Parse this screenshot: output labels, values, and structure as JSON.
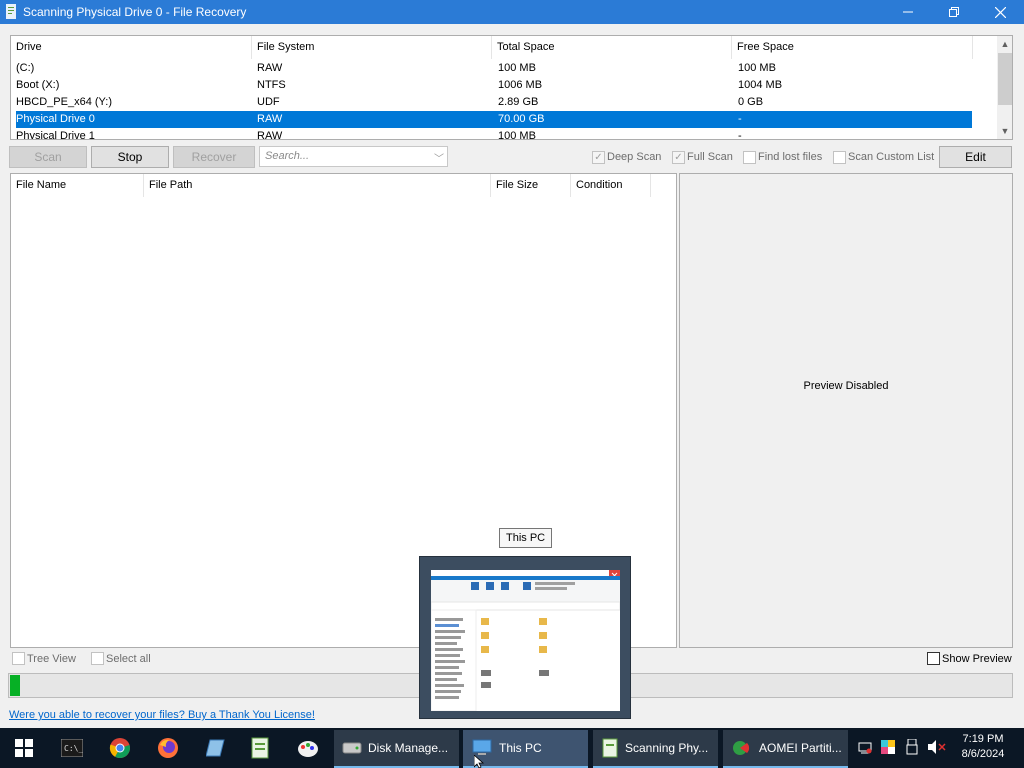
{
  "window": {
    "title": "Scanning Physical Drive 0 - File Recovery",
    "controls": {
      "minimize": "—",
      "restore": "❐",
      "close": "✕"
    }
  },
  "drive_table": {
    "columns": [
      "Drive",
      "File System",
      "Total Space",
      "Free Space"
    ],
    "rows": [
      {
        "drive": " (C:)",
        "fs": "RAW",
        "total": "100 MB",
        "free": "100 MB"
      },
      {
        "drive": "Boot (X:)",
        "fs": "NTFS",
        "total": "1006 MB",
        "free": "1004 MB"
      },
      {
        "drive": "HBCD_PE_x64 (Y:)",
        "fs": "UDF",
        "total": "2.89 GB",
        "free": "0 GB"
      },
      {
        "drive": "Physical Drive 0",
        "fs": "RAW",
        "total": "70.00 GB",
        "free": "-"
      },
      {
        "drive": "Physical Drive 1",
        "fs": "RAW",
        "total": "100 MB",
        "free": "-"
      }
    ],
    "selected_row": "Physical Drive 0"
  },
  "toolbar": {
    "scan": "Scan",
    "stop": "Stop",
    "recover": "Recover",
    "search_placeholder": "Search...",
    "deep_scan": "Deep Scan",
    "full_scan": "Full Scan",
    "find_lost_files": "Find lost files",
    "scan_custom_list": "Scan Custom List",
    "edit": "Edit"
  },
  "file_table": {
    "columns": [
      "File Name",
      "File Path",
      "File Size",
      "Condition"
    ]
  },
  "preview": {
    "text": "Preview Disabled"
  },
  "options": {
    "tree_view": "Tree View",
    "select_all": "Select all",
    "show_preview": "Show Preview"
  },
  "progress": {
    "fraction": 0.01
  },
  "link_text": "Were you able to recover your files? Buy a Thank You License!",
  "tooltip": "This PC",
  "taskbar": {
    "apps": [
      {
        "label": "Disk Manage...",
        "icon": "disk-management-icon"
      },
      {
        "label": "This PC",
        "icon": "this-pc-icon"
      },
      {
        "label": "Scanning Phy...",
        "icon": "file-recovery-icon"
      },
      {
        "label": "AOMEI Partiti...",
        "icon": "aomei-icon"
      }
    ],
    "time": "7:19 PM",
    "date": "8/6/2024"
  },
  "colors": {
    "titlebar": "#2b7bd6",
    "selection": "#0078d7",
    "progress_fill": "#06b025",
    "link": "#0066cc",
    "taskbar": "#0b1725"
  }
}
